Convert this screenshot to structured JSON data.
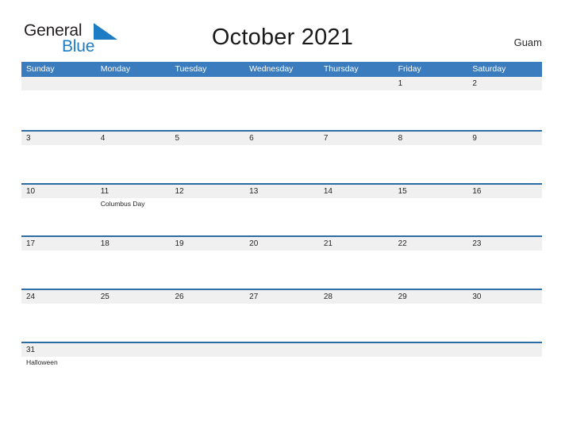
{
  "brand": {
    "name_part1": "General",
    "name_part2": "Blue",
    "flag_icon": "flag-triangle-icon",
    "color_dark": "#231f20",
    "color_blue": "#1d7cc4"
  },
  "header": {
    "title": "October 2021",
    "location": "Guam"
  },
  "theme": {
    "header_blue": "#3a7cbd",
    "rule_blue": "#2e6da4",
    "band_gray": "#f0f0f0",
    "text_dark": "#262626"
  },
  "calendar": {
    "weekdays": [
      "Sunday",
      "Monday",
      "Tuesday",
      "Wednesday",
      "Thursday",
      "Friday",
      "Saturday"
    ],
    "weeks": [
      [
        {
          "date": "",
          "event": ""
        },
        {
          "date": "",
          "event": ""
        },
        {
          "date": "",
          "event": ""
        },
        {
          "date": "",
          "event": ""
        },
        {
          "date": "",
          "event": ""
        },
        {
          "date": "1",
          "event": ""
        },
        {
          "date": "2",
          "event": ""
        }
      ],
      [
        {
          "date": "3",
          "event": ""
        },
        {
          "date": "4",
          "event": ""
        },
        {
          "date": "5",
          "event": ""
        },
        {
          "date": "6",
          "event": ""
        },
        {
          "date": "7",
          "event": ""
        },
        {
          "date": "8",
          "event": ""
        },
        {
          "date": "9",
          "event": ""
        }
      ],
      [
        {
          "date": "10",
          "event": ""
        },
        {
          "date": "11",
          "event": "Columbus Day"
        },
        {
          "date": "12",
          "event": ""
        },
        {
          "date": "13",
          "event": ""
        },
        {
          "date": "14",
          "event": ""
        },
        {
          "date": "15",
          "event": ""
        },
        {
          "date": "16",
          "event": ""
        }
      ],
      [
        {
          "date": "17",
          "event": ""
        },
        {
          "date": "18",
          "event": ""
        },
        {
          "date": "19",
          "event": ""
        },
        {
          "date": "20",
          "event": ""
        },
        {
          "date": "21",
          "event": ""
        },
        {
          "date": "22",
          "event": ""
        },
        {
          "date": "23",
          "event": ""
        }
      ],
      [
        {
          "date": "24",
          "event": ""
        },
        {
          "date": "25",
          "event": ""
        },
        {
          "date": "26",
          "event": ""
        },
        {
          "date": "27",
          "event": ""
        },
        {
          "date": "28",
          "event": ""
        },
        {
          "date": "29",
          "event": ""
        },
        {
          "date": "30",
          "event": ""
        }
      ],
      [
        {
          "date": "31",
          "event": "Halloween"
        },
        {
          "date": "",
          "event": ""
        },
        {
          "date": "",
          "event": ""
        },
        {
          "date": "",
          "event": ""
        },
        {
          "date": "",
          "event": ""
        },
        {
          "date": "",
          "event": ""
        },
        {
          "date": "",
          "event": ""
        }
      ]
    ]
  }
}
